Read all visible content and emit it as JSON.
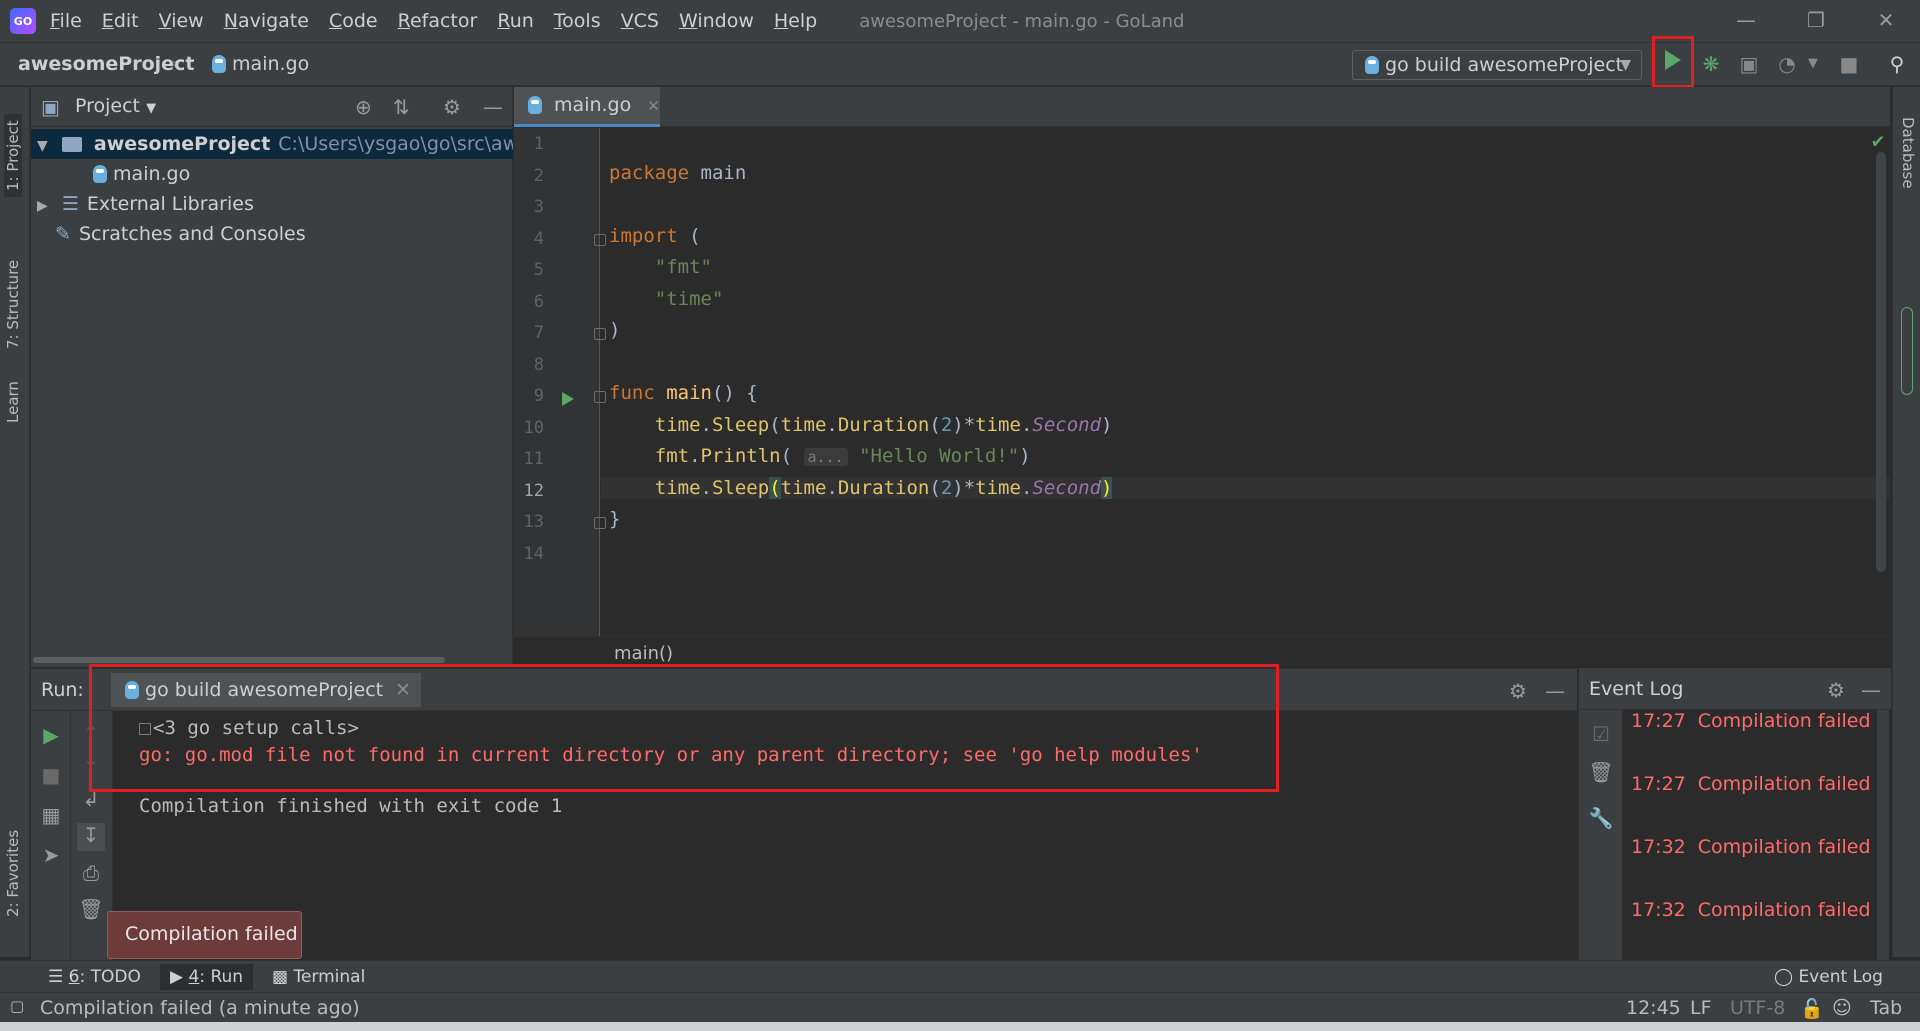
{
  "app": {
    "logo_text": "GO",
    "window_title": "awesomeProject - main.go - GoLand"
  },
  "menu": [
    {
      "mn": "F",
      "rest": "ile"
    },
    {
      "mn": "E",
      "rest": "dit"
    },
    {
      "mn": "V",
      "rest": "iew"
    },
    {
      "mn": "N",
      "rest": "avigate"
    },
    {
      "mn": "C",
      "rest": "ode"
    },
    {
      "mn": "R",
      "rest": "efactor"
    },
    {
      "mn": "R",
      "rest": "un"
    },
    {
      "mn": "T",
      "rest": "ools"
    },
    {
      "mn": "V",
      "rest": "CS"
    },
    {
      "mn": "W",
      "rest": "indow"
    },
    {
      "mn": "H",
      "rest": "elp"
    }
  ],
  "navbar": {
    "project": "awesomeProject",
    "file": "main.go",
    "run_config": "go build awesomeProject"
  },
  "left_tabs": {
    "project": "1: Project",
    "structure": "7: Structure",
    "learn": "Learn",
    "favorites": "2: Favorites"
  },
  "right_tabs": {
    "database": "Database"
  },
  "project_pane": {
    "title": "Project",
    "root_name": "awesomeProject",
    "root_path": "C:\\Users\\ysgao\\go\\src\\awesom",
    "file": "main.go",
    "external": "External Libraries",
    "scratches": "Scratches and Consoles"
  },
  "editor": {
    "tab": "main.go",
    "line_numbers": [
      "1",
      "2",
      "3",
      "4",
      "5",
      "6",
      "7",
      "8",
      "9",
      "10",
      "11",
      "12",
      "13",
      "14"
    ],
    "current_line": "12",
    "tokens": {
      "package_kw": "package",
      "package_name": "main",
      "import_kw": "import",
      "open_paren": "(",
      "fmt_str": "\"fmt\"",
      "time_str": "\"time\"",
      "close_paren": ")",
      "func_kw": "func",
      "main_fn": "main",
      "main_tail": "() {",
      "time_pkg": "time",
      "dot": ".",
      "sleep_fn": "Sleep",
      "duration_fn": "Duration",
      "two": "2",
      "second": "Second",
      "fmt_pkg": "fmt",
      "println_fn": "Println",
      "hint": "a...",
      "hello_str": "\"Hello World!\"",
      "close_brace": "}"
    },
    "breadcrumb": "main()"
  },
  "run_panel": {
    "label": "Run:",
    "tab": "go build awesomeProject",
    "output": {
      "setup": "<3 go setup calls>",
      "error": "go: go.mod file not found in current directory or any parent directory; see 'go help modules'",
      "finished": "Compilation finished with exit code 1"
    }
  },
  "event_log": {
    "title": "Event Log",
    "entries": [
      {
        "time": "17:27",
        "message": "Compilation failed"
      },
      {
        "time": "17:27",
        "message": "Compilation failed"
      },
      {
        "time": "17:32",
        "message": "Compilation failed"
      },
      {
        "time": "17:32",
        "message": "Compilation failed"
      }
    ]
  },
  "tooltip": "Compilation failed",
  "bottom_tabs": {
    "todo_num": "6",
    "todo": ": TODO",
    "run_num": "4",
    "run": ": Run",
    "terminal": "Terminal",
    "event_log": "Event Log"
  },
  "status": {
    "message": "Compilation failed (a minute ago)",
    "position": "12:45",
    "line_sep": "LF",
    "encoding": "UTF-8",
    "indent": "Tab"
  },
  "colors": {
    "highlight_box": "#e02020",
    "error_text": "#ff6b68",
    "run_green": "#59a869"
  }
}
